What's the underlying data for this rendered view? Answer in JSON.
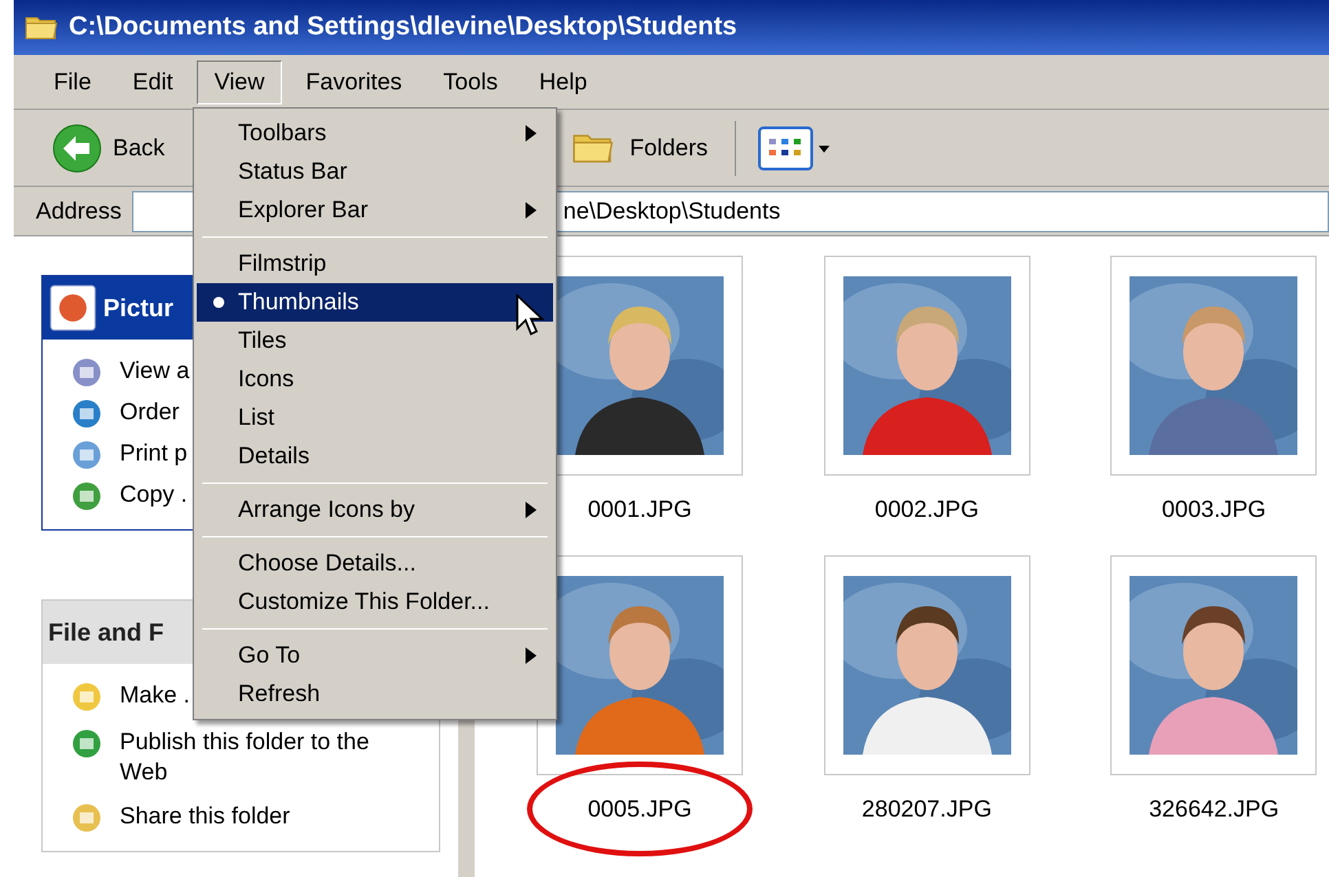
{
  "window": {
    "title": "C:\\Documents and Settings\\dlevine\\Desktop\\Students"
  },
  "menu_bar": [
    {
      "label": "File",
      "selected": false
    },
    {
      "label": "Edit",
      "selected": false
    },
    {
      "label": "View",
      "selected": true
    },
    {
      "label": "Favorites",
      "selected": false
    },
    {
      "label": "Tools",
      "selected": false
    },
    {
      "label": "Help",
      "selected": false
    }
  ],
  "toolbar": {
    "back": "Back",
    "folders": "Folders"
  },
  "address": {
    "label": "Address",
    "value": "ne\\Desktop\\Students"
  },
  "view_menu": [
    {
      "kind": "item",
      "label": "Toolbars",
      "submenu": true,
      "selected": false,
      "highlighted": false
    },
    {
      "kind": "item",
      "label": "Status Bar",
      "submenu": false,
      "selected": false,
      "highlighted": false
    },
    {
      "kind": "item",
      "label": "Explorer Bar",
      "submenu": true,
      "selected": false,
      "highlighted": false
    },
    {
      "kind": "separator"
    },
    {
      "kind": "item",
      "label": "Filmstrip",
      "submenu": false,
      "selected": false,
      "highlighted": false
    },
    {
      "kind": "item",
      "label": "Thumbnails",
      "submenu": false,
      "selected": true,
      "highlighted": true
    },
    {
      "kind": "item",
      "label": "Tiles",
      "submenu": false,
      "selected": false,
      "highlighted": false
    },
    {
      "kind": "item",
      "label": "Icons",
      "submenu": false,
      "selected": false,
      "highlighted": false
    },
    {
      "kind": "item",
      "label": "List",
      "submenu": false,
      "selected": false,
      "highlighted": false
    },
    {
      "kind": "item",
      "label": "Details",
      "submenu": false,
      "selected": false,
      "highlighted": false
    },
    {
      "kind": "separator"
    },
    {
      "kind": "item",
      "label": "Arrange Icons by",
      "submenu": true,
      "selected": false,
      "highlighted": false
    },
    {
      "kind": "separator"
    },
    {
      "kind": "item",
      "label": "Choose Details...",
      "submenu": false,
      "selected": false,
      "highlighted": false
    },
    {
      "kind": "item",
      "label": "Customize This Folder...",
      "submenu": false,
      "selected": false,
      "highlighted": false
    },
    {
      "kind": "separator"
    },
    {
      "kind": "item",
      "label": "Go To",
      "submenu": true,
      "selected": false,
      "highlighted": false
    },
    {
      "kind": "item",
      "label": "Refresh",
      "submenu": false,
      "selected": false,
      "highlighted": false
    }
  ],
  "task_panes": [
    {
      "title": "Pictur",
      "kind": "picture",
      "items": [
        "View a",
        "Order",
        "Print p",
        "Copy ."
      ]
    },
    {
      "title": "File and F",
      "kind": "file",
      "items": [
        "Make .",
        "Publish this folder to the Web",
        "Share this folder"
      ]
    }
  ],
  "files": [
    {
      "name": "0001.JPG",
      "annotated": false
    },
    {
      "name": "0002.JPG",
      "annotated": false
    },
    {
      "name": "0003.JPG",
      "annotated": false
    },
    {
      "name": "0005.JPG",
      "annotated": true
    },
    {
      "name": "280207.JPG",
      "annotated": false
    },
    {
      "name": "326642.JPG",
      "annotated": false
    }
  ]
}
